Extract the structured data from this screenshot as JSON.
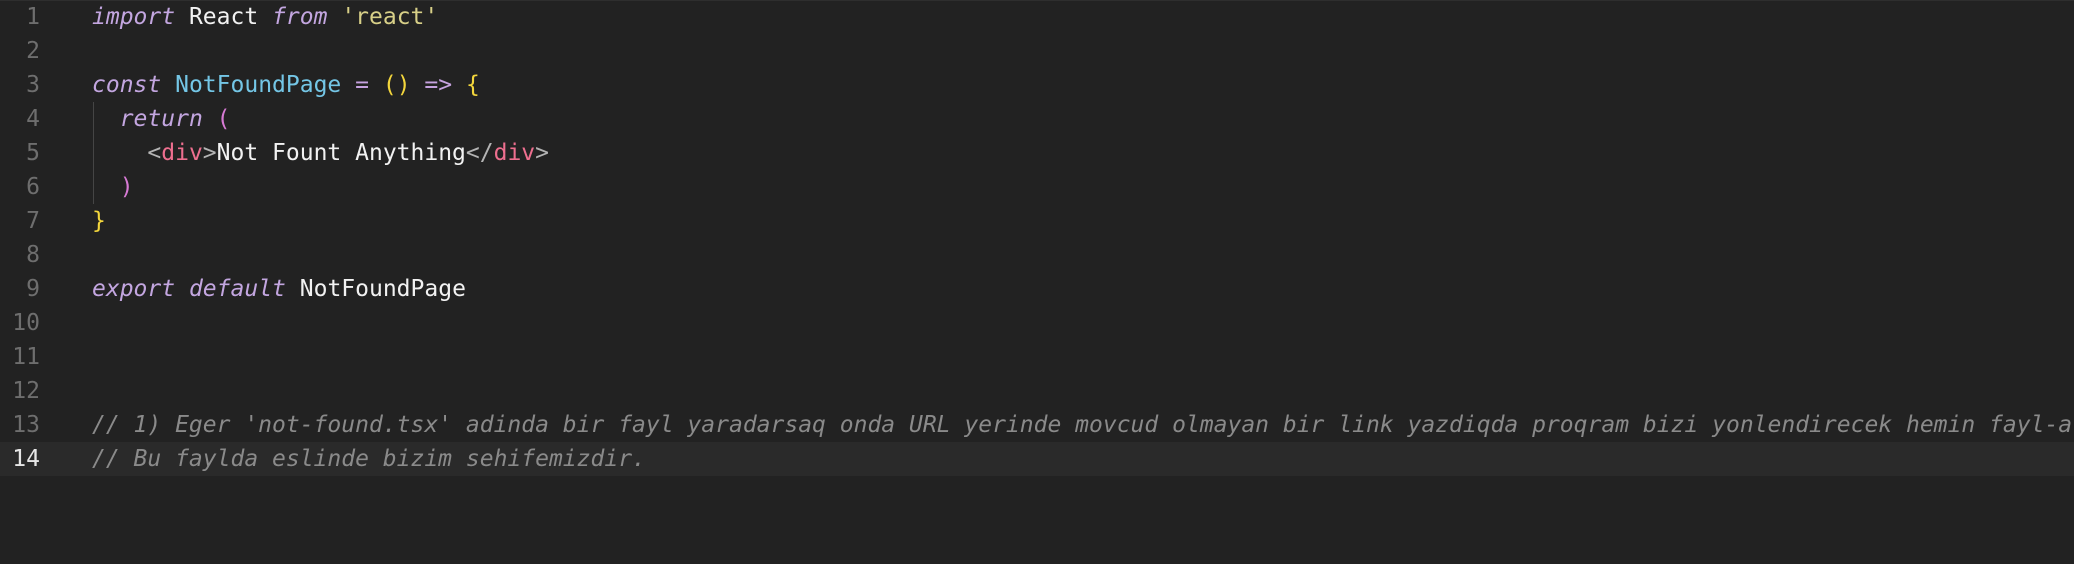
{
  "editor": {
    "current_line": 14,
    "lines": [
      {
        "number": "1",
        "tokens": [
          {
            "t": "import",
            "c": "kw"
          },
          {
            "t": " "
          },
          {
            "t": "React",
            "c": "id"
          },
          {
            "t": " "
          },
          {
            "t": "from",
            "c": "kw"
          },
          {
            "t": " "
          },
          {
            "t": "'react'",
            "c": "str"
          }
        ]
      },
      {
        "number": "2",
        "tokens": []
      },
      {
        "number": "3",
        "tokens": [
          {
            "t": "const",
            "c": "kw"
          },
          {
            "t": " "
          },
          {
            "t": "NotFoundPage",
            "c": "fn"
          },
          {
            "t": " "
          },
          {
            "t": "=",
            "c": "op"
          },
          {
            "t": " "
          },
          {
            "t": "()",
            "c": "b1"
          },
          {
            "t": " "
          },
          {
            "t": "=>",
            "c": "op"
          },
          {
            "t": " "
          },
          {
            "t": "{",
            "c": "b1"
          }
        ]
      },
      {
        "number": "4",
        "tokens": [
          {
            "t": "  "
          },
          {
            "t": "return",
            "c": "kw"
          },
          {
            "t": " "
          },
          {
            "t": "(",
            "c": "b2"
          }
        ]
      },
      {
        "number": "5",
        "tokens": [
          {
            "t": "    "
          },
          {
            "t": "<",
            "c": "tagp"
          },
          {
            "t": "div",
            "c": "tagn"
          },
          {
            "t": ">",
            "c": "tagp"
          },
          {
            "t": "Not Fount Anything",
            "c": "txt"
          },
          {
            "t": "</",
            "c": "tagp"
          },
          {
            "t": "div",
            "c": "tagn"
          },
          {
            "t": ">",
            "c": "tagp"
          }
        ]
      },
      {
        "number": "6",
        "tokens": [
          {
            "t": "  "
          },
          {
            "t": ")",
            "c": "b2"
          }
        ]
      },
      {
        "number": "7",
        "tokens": [
          {
            "t": "}",
            "c": "b1"
          }
        ]
      },
      {
        "number": "8",
        "tokens": []
      },
      {
        "number": "9",
        "tokens": [
          {
            "t": "export",
            "c": "kw"
          },
          {
            "t": " "
          },
          {
            "t": "default",
            "c": "kw"
          },
          {
            "t": " "
          },
          {
            "t": "NotFoundPage",
            "c": "id"
          }
        ]
      },
      {
        "number": "10",
        "tokens": []
      },
      {
        "number": "11",
        "tokens": []
      },
      {
        "number": "12",
        "tokens": []
      },
      {
        "number": "13",
        "tokens": [
          {
            "t": "// 1) Eger 'not-found.tsx' adinda bir fayl yaradarsaq onda URL yerinde movcud olmayan bir link yazdiqda proqram bizi yonlendirecek hemin fayl-a",
            "c": "cm"
          }
        ]
      },
      {
        "number": "14",
        "tokens": [
          {
            "t": "// Bu faylda eslinde bizim sehifemizdir.",
            "c": "cm"
          }
        ]
      }
    ]
  }
}
